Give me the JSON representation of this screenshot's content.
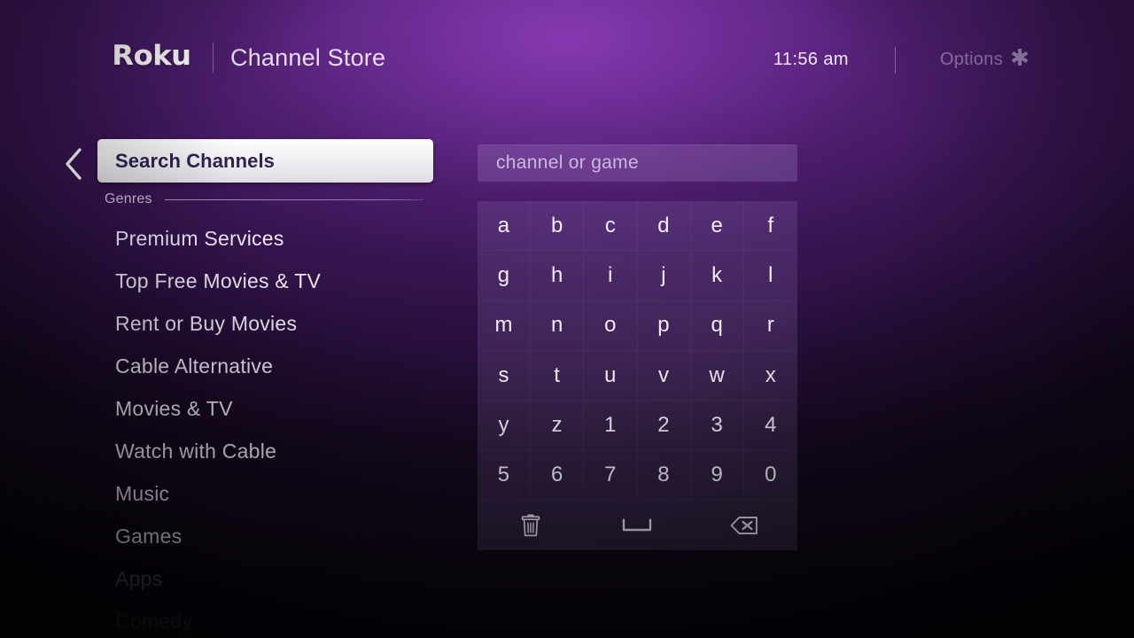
{
  "header": {
    "logo": "Roku",
    "title": "Channel Store",
    "time": "11:56 am",
    "options_label": "Options",
    "options_icon": "asterisk-icon",
    "separator": "|"
  },
  "sidebar": {
    "back_icon": "chevron-left-icon",
    "selected_item": "Search Channels",
    "section_label": "Genres",
    "items": [
      {
        "label": "Premium Services",
        "dimmed": false
      },
      {
        "label": "Top Free Movies & TV",
        "dimmed": false
      },
      {
        "label": "Rent or Buy Movies",
        "dimmed": false
      },
      {
        "label": "Cable Alternative",
        "dimmed": false
      },
      {
        "label": "Movies & TV",
        "dimmed": false
      },
      {
        "label": "Watch with Cable",
        "dimmed": false
      },
      {
        "label": "Music",
        "dimmed": false
      },
      {
        "label": "Games",
        "dimmed": false
      },
      {
        "label": "Apps",
        "dimmed": true
      },
      {
        "label": "Comedy",
        "dimmed": true
      }
    ]
  },
  "search": {
    "value": "",
    "placeholder": "channel or game"
  },
  "keyboard": {
    "keys": [
      "a",
      "b",
      "c",
      "d",
      "e",
      "f",
      "g",
      "h",
      "i",
      "j",
      "k",
      "l",
      "m",
      "n",
      "o",
      "p",
      "q",
      "r",
      "s",
      "t",
      "u",
      "v",
      "w",
      "x",
      "y",
      "z",
      "1",
      "2",
      "3",
      "4",
      "5",
      "6",
      "7",
      "8",
      "9",
      "0"
    ],
    "function_keys": [
      {
        "name": "clear-key",
        "icon": "trash-icon"
      },
      {
        "name": "space-key",
        "icon": "space-bar-icon"
      },
      {
        "name": "backspace-key",
        "icon": "backspace-icon"
      }
    ]
  },
  "colors": {
    "accent_purple": "#6d2d93",
    "panel_purple": "#4a3564",
    "highlight_bg": "#f2f1f3",
    "highlight_text": "#2f2250",
    "text_primary": "#efe7f6",
    "text_dim": "#8a7a9c"
  }
}
